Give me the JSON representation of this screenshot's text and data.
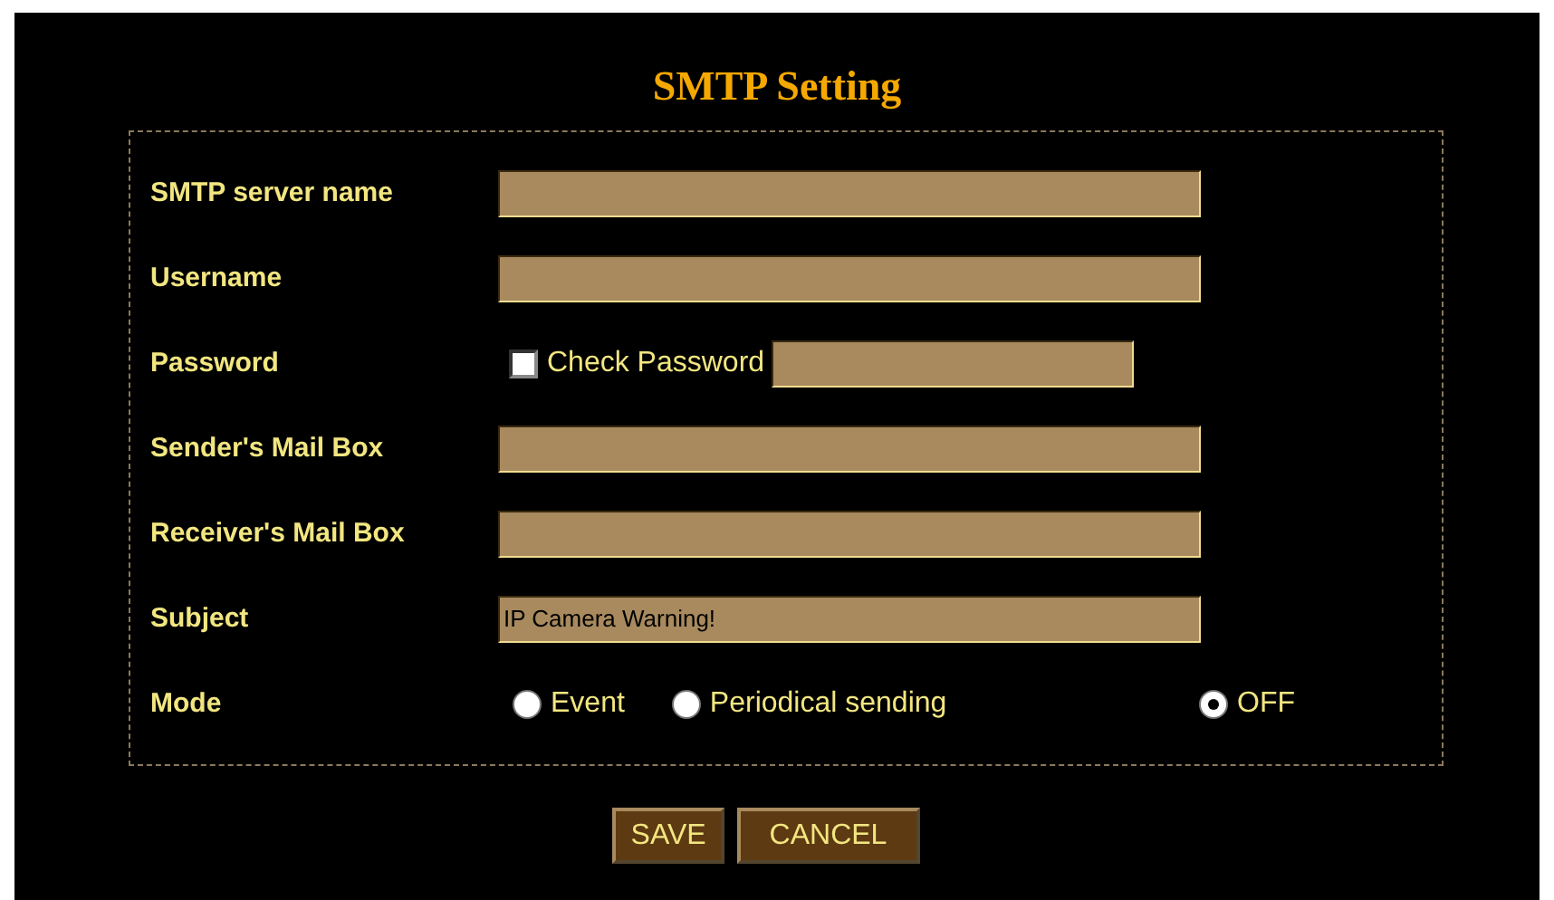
{
  "title": "SMTP Setting",
  "fields": [
    {
      "kind": "text",
      "label": "SMTP server name"
    },
    {
      "kind": "text",
      "label": "Username"
    },
    {
      "kind": "password",
      "label": "Password",
      "check_label": "Check Password",
      "checked": false
    },
    {
      "kind": "text",
      "label": "Sender's Mail Box"
    },
    {
      "kind": "text",
      "label": "Receiver's Mail Box"
    },
    {
      "kind": "text",
      "label": "Subject",
      "value": "IP Camera Warning!"
    },
    {
      "kind": "radio",
      "label": "Mode",
      "options": [
        {
          "label": "Event",
          "selected": false
        },
        {
          "label": "Periodical sending",
          "selected": false
        },
        {
          "label": "OFF",
          "selected": true
        }
      ]
    }
  ],
  "buttons": [
    "SAVE",
    "CANCEL"
  ]
}
